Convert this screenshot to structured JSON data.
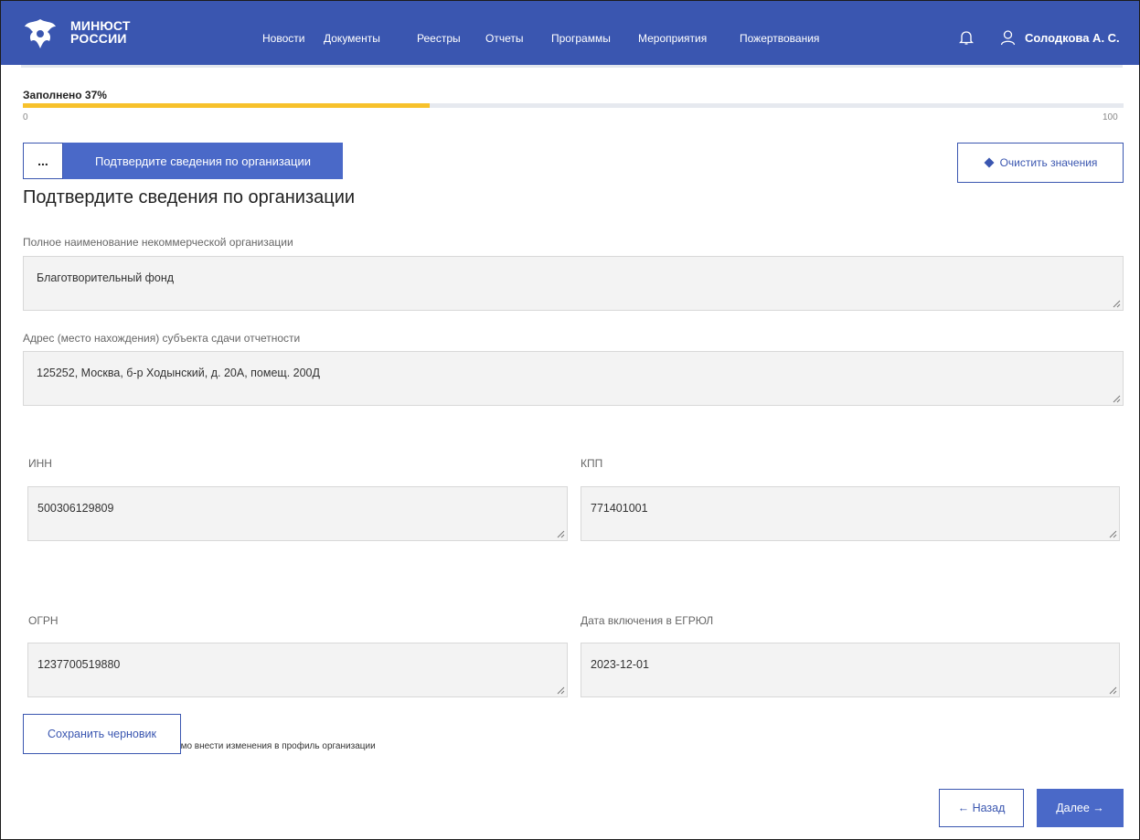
{
  "header": {
    "logo_line1": "МИНЮСТ",
    "logo_line2": "РОССИИ",
    "nav": [
      "Новости",
      "Документы",
      "Реестры",
      "Отчеты",
      "Программы",
      "Мероприятия",
      "Пожертвования"
    ],
    "user_name": "Солодкова А. С.",
    "icons": {
      "bell": "bell-icon",
      "user": "user-icon",
      "logo": "eagle-emblem-icon"
    },
    "bg_color": "#3a56b0"
  },
  "progress": {
    "label": "Заполнено 37%",
    "value": 37,
    "min_label": "0",
    "max_label": "100",
    "fill_color": "#f7c12b"
  },
  "steps": {
    "more_label": "...",
    "active_label": "Подтвердите сведения по организации"
  },
  "clear_button": {
    "label": "Очистить значения",
    "icon": "eraser-icon"
  },
  "page_title": "Подтвердите сведения по организации",
  "fields": {
    "full_name": {
      "label": "Полное наименование некоммерческой организации",
      "value": "Благотворительный фонд"
    },
    "address": {
      "label": "Адрес (место нахождения) субъекта сдачи отчетности",
      "value": "125252, Москва, б-р Ходынский, д. 20А, помещ. 200Д"
    },
    "inn": {
      "label": "ИНН",
      "value": "500306129809"
    },
    "kpp": {
      "label": "КПП",
      "value": "771401001"
    },
    "ogrn": {
      "label": "ОГРН",
      "value": "1237700519880"
    },
    "egrul_date": {
      "label": "Дата включения в ЕГРЮЛ",
      "value": "2023-12-01"
    }
  },
  "note": "Если данные некорректны, необходимо внести изменения в профиль организации",
  "footer": {
    "draft_label": "Сохранить черновик",
    "back_label": "← Назад",
    "next_label": "Далее →"
  },
  "accent_color": "#4a69c8"
}
